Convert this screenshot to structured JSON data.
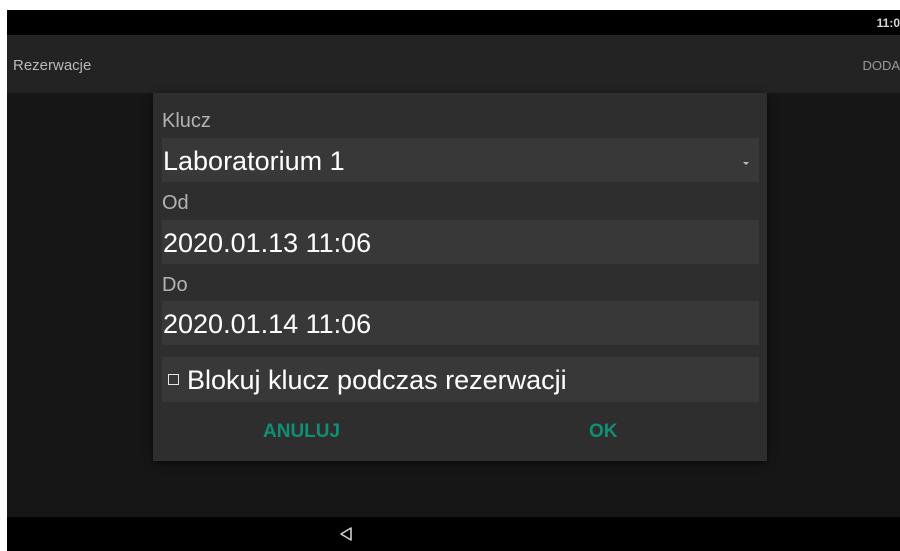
{
  "status_bar": {
    "time": "11:0"
  },
  "app_bar": {
    "title": "Rezerwacje",
    "action": "DODA"
  },
  "dialog": {
    "key_label": "Klucz",
    "key_value": "Laboratorium 1",
    "from_label": "Od",
    "from_value": "2020.01.13 11:06",
    "to_label": "Do",
    "to_value": "2020.01.14 11:06",
    "lock_checkbox_label": "Blokuj klucz podczas rezerwacji",
    "lock_checked": false,
    "cancel_label": "ANULUJ",
    "ok_label": "OK"
  },
  "nav_bar": {
    "icons": [
      "back-icon"
    ]
  },
  "colors": {
    "accent": "#0f8f74",
    "dialog_bg": "#2e2e2e",
    "field_bg": "#383838",
    "background": "#161616"
  }
}
